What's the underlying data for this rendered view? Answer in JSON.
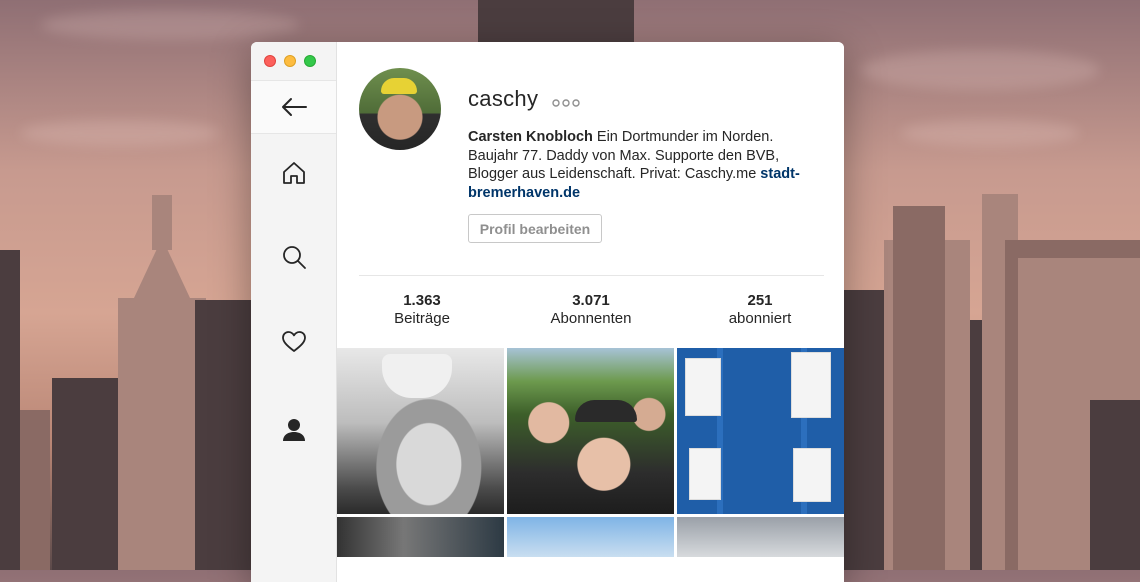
{
  "window": {
    "traffic_lights": [
      "close",
      "minimize",
      "zoom"
    ]
  },
  "sidebar": {
    "items": [
      {
        "name": "back",
        "icon": "arrow-left-icon"
      },
      {
        "name": "home",
        "icon": "home-icon"
      },
      {
        "name": "search",
        "icon": "search-icon"
      },
      {
        "name": "activity",
        "icon": "heart-icon"
      },
      {
        "name": "profile",
        "icon": "person-icon",
        "active": true
      }
    ]
  },
  "profile": {
    "username": "caschy",
    "more_icon": "ellipsis-icon",
    "full_name": "Carsten Knobloch",
    "bio_text": " Ein Dortmunder im Norden. Baujahr 77. Daddy von Max. Supporte den BVB, Blogger aus Leidenschaft. Privat: Caschy.me ",
    "bio_link": "stadt-bremerhaven.de",
    "edit_button": "Profil bearbeiten"
  },
  "stats": [
    {
      "number": "1.363",
      "label": "Beiträge"
    },
    {
      "number": "3.071",
      "label": "Abonnenten"
    },
    {
      "number": "251",
      "label": "abonniert"
    }
  ],
  "colors": {
    "link": "#003569",
    "text": "#262626",
    "button_text": "#8f8f8f"
  }
}
